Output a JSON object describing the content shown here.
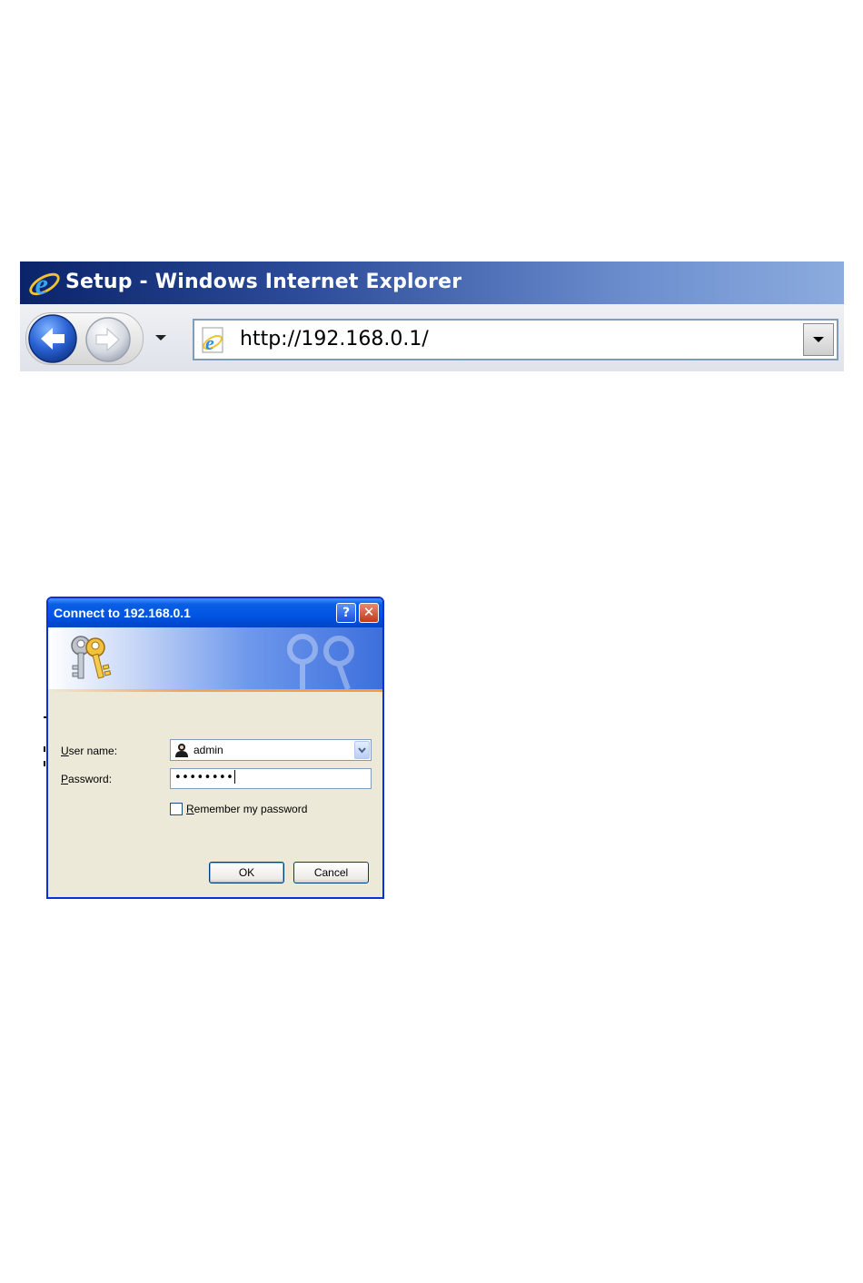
{
  "browser": {
    "window_title": "Setup - Windows Internet Explorer",
    "address_url": "http://192.168.0.1/",
    "icons": {
      "logo": "ie-logo-icon",
      "back": "back-arrow-icon",
      "forward": "forward-arrow-icon",
      "history": "dropdown-arrow-icon",
      "page": "ie-page-icon",
      "address_dropdown": "dropdown-arrow-icon"
    }
  },
  "dialog": {
    "title": "Connect to 192.168.0.1",
    "help_glyph": "?",
    "close_glyph": "✕",
    "user_label_accel": "U",
    "user_label_rest": "ser name:",
    "user_value": "admin",
    "password_label_accel": "P",
    "password_label_rest": "assword:",
    "password_value": "••••••••",
    "remember_accel": "R",
    "remember_rest": "emember my password",
    "remember_checked": false,
    "ok_label": "OK",
    "cancel_label": "Cancel",
    "colors": {
      "titlebar": "#0054e3",
      "body": "#ece9d8",
      "border": "#0831d9"
    }
  }
}
